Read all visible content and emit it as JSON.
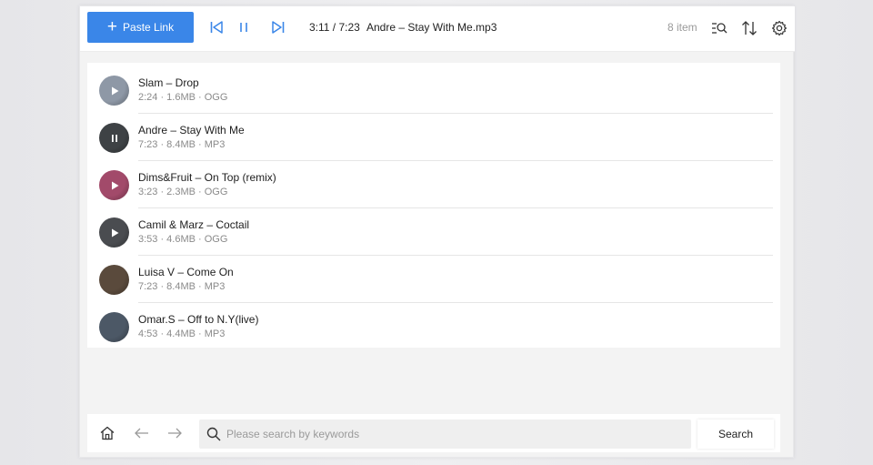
{
  "toolbar": {
    "paste_label": "Paste Link",
    "time": "3:11 / 7:23",
    "now_playing": "Andre – Stay With Me.mp3",
    "item_count": "8 item"
  },
  "tracks": [
    {
      "title": "Slam – Drop",
      "meta": "2:24 · 1.6MB · OGG",
      "state": "play",
      "color": "#8e98a6"
    },
    {
      "title": "Andre – Stay With Me",
      "meta": "7:23 · 8.4MB · MP3",
      "state": "pause",
      "color": "#3e4245"
    },
    {
      "title": "Dims&Fruit – On Top (remix)",
      "meta": "3:23 · 2.3MB · OGG",
      "state": "play",
      "color": "#a24a6a"
    },
    {
      "title": "Camil & Marz – Coctail",
      "meta": "3:53 · 4.6MB · OGG",
      "state": "play",
      "color": "#4a4c50"
    },
    {
      "title": "Luisa V – Come On",
      "meta": "7:23 · 8.4MB · MP3",
      "state": "none",
      "color": "#5a4a3c"
    },
    {
      "title": "Omar.S – Off to N.Y(live)",
      "meta": "4:53 · 4.4MB · MP3",
      "state": "none",
      "color": "#4c5866"
    }
  ],
  "search": {
    "placeholder": "Please search by keywords",
    "button_label": "Search"
  },
  "colors": {
    "accent": "#3a86e8"
  }
}
